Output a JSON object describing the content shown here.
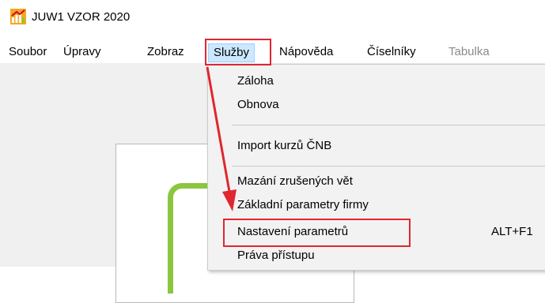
{
  "window": {
    "title": "JUW1 VZOR 2020",
    "icon": "app-chart-icon"
  },
  "menubar": {
    "items": [
      {
        "label": "Soubor"
      },
      {
        "label": "Úpravy"
      },
      {
        "label": "Zobraz"
      },
      {
        "label": "Služby"
      },
      {
        "label": "Nápověda"
      },
      {
        "label": "Číselníky"
      },
      {
        "label": "Tabulka"
      }
    ],
    "active_item": "Služby",
    "disabled_item": "Tabulka"
  },
  "dropdown": {
    "items": [
      {
        "label": "Záloha"
      },
      {
        "label": "Obnova"
      },
      {
        "label": "Import kurzů ČNB"
      },
      {
        "label": "Mazání zrušených vět"
      },
      {
        "label": "Základní parametry firmy"
      },
      {
        "label": "Nastavení parametrů",
        "shortcut": "ALT+F1"
      },
      {
        "label": "Práva přístupu"
      }
    ]
  },
  "annotation": {
    "color": "#e0262f",
    "highlighted": [
      "Služby",
      "Nastavení parametrů"
    ]
  },
  "colors": {
    "accent_green": "#8cc63f",
    "menu_active_bg": "#cce8ff"
  }
}
